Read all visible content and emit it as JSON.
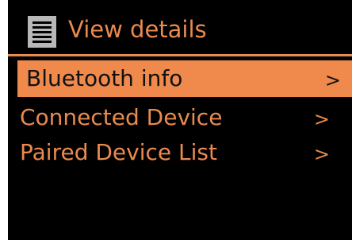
{
  "header": {
    "title": "View details",
    "icon": "menu-list-icon"
  },
  "menu": {
    "items": [
      {
        "label": "Bluetooth info",
        "chevron": ">",
        "selected": true
      },
      {
        "label": "Connected Device",
        "chevron": ">",
        "selected": false
      },
      {
        "label": "Paired Device List",
        "chevron": ">",
        "selected": false
      }
    ]
  },
  "colors": {
    "background": "#000000",
    "accent": "#ef8a4c",
    "text_accent": "#e98a4f",
    "icon": "#b8b8b8"
  }
}
